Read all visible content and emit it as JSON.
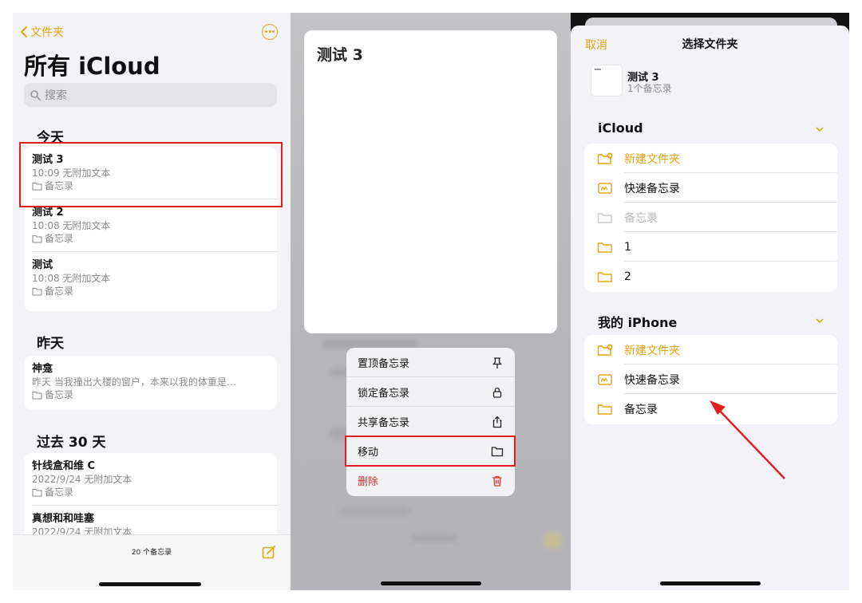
{
  "colors": {
    "accent": "#e2a510",
    "danger": "#e0312c",
    "highlight": "#e01e1e"
  },
  "left": {
    "back_label": "文件夹",
    "title": "所有 iCloud",
    "search_placeholder": "搜索",
    "sections": [
      {
        "label": "今天",
        "notes": [
          {
            "title": "测试 3",
            "meta": "10:09  无附加文本",
            "folder": "备忘录"
          },
          {
            "title": "测试 2",
            "meta": "10:08  无附加文本",
            "folder": "备忘录"
          },
          {
            "title": "测试",
            "meta": "10:08  无附加文本",
            "folder": "备忘录"
          }
        ]
      },
      {
        "label": "昨天",
        "notes": [
          {
            "title": "神龛",
            "meta": "昨天  当我撞出大楼的窗户，本来以我的体重是…",
            "folder": "备忘录"
          }
        ]
      },
      {
        "label": "过去 30 天",
        "notes": [
          {
            "title": "针线盒和维 C",
            "meta": "2022/9/24  无附加文本",
            "folder": "备忘录"
          },
          {
            "title": "真想和和哇塞",
            "meta": "2022/9/24  无附加文本",
            "folder": ""
          }
        ]
      }
    ],
    "note_count": "20 个备忘录"
  },
  "middle": {
    "note_title": "测试 3",
    "menu": [
      {
        "label": "置顶备忘录",
        "icon": "pin-icon"
      },
      {
        "label": "锁定备忘录",
        "icon": "lock-icon"
      },
      {
        "label": "共享备忘录",
        "icon": "share-icon"
      },
      {
        "label": "移动",
        "icon": "folder-icon"
      },
      {
        "label": "删除",
        "icon": "trash-icon"
      }
    ]
  },
  "right": {
    "cancel_label": "取消",
    "title": "选择文件夹",
    "selected_note": {
      "title": "测试 3",
      "subtitle": "1个备忘录"
    },
    "icloud": {
      "label": "iCloud",
      "items": [
        {
          "label": "新建文件夹",
          "icon": "new-folder-icon"
        },
        {
          "label": "快速备忘录",
          "icon": "quick-note-icon"
        },
        {
          "label": "备忘录",
          "icon": "folder-icon"
        },
        {
          "label": "1",
          "icon": "folder-icon"
        },
        {
          "label": "2",
          "icon": "folder-icon"
        }
      ]
    },
    "iphone": {
      "label": "我的 iPhone",
      "items": [
        {
          "label": "新建文件夹",
          "icon": "new-folder-icon"
        },
        {
          "label": "快速备忘录",
          "icon": "quick-note-icon"
        },
        {
          "label": "备忘录",
          "icon": "folder-icon"
        }
      ]
    }
  }
}
